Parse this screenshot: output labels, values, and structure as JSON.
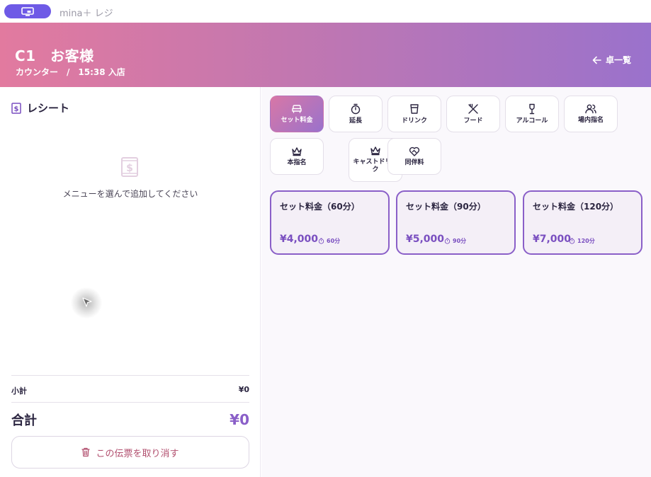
{
  "app": {
    "name": "mina＋ レジ"
  },
  "header": {
    "title": "C1　お客様",
    "subtitle": "カウンター　/　15:38 入店",
    "back_label": "卓一覧"
  },
  "receipt": {
    "heading": "レシート",
    "empty_message": "メニューを選んで追加してください",
    "subtotal_label": "小計",
    "subtotal_value": "¥0",
    "total_label": "合計",
    "total_value": "¥0",
    "cancel_label": "この伝票を取り消す"
  },
  "categories": [
    {
      "label": "セット料金",
      "icon": "sofa-icon",
      "active": true
    },
    {
      "label": "延長",
      "icon": "timer-icon"
    },
    {
      "label": "ドリンク",
      "icon": "cup-icon"
    },
    {
      "label": "フード",
      "icon": "utensils-icon"
    },
    {
      "label": "アルコール",
      "icon": "wine-icon"
    },
    {
      "label": "場内指名",
      "icon": "users-icon"
    },
    {
      "label": "本指名",
      "icon": "crown-icon"
    },
    {
      "label": "キャストドリンク",
      "icon": "crown-icon"
    },
    {
      "label": "同伴料",
      "icon": "heart-handshake-icon"
    }
  ],
  "items": [
    {
      "title": "セット料金（60分）",
      "price": "¥4,000",
      "duration": "60分"
    },
    {
      "title": "セット料金（90分）",
      "price": "¥5,000",
      "duration": "90分"
    },
    {
      "title": "セット料金（120分）",
      "price": "¥7,000",
      "duration": "120分"
    }
  ],
  "colors": {
    "accent": "#8a5fc8",
    "header_gradient_start": "#e27a9f",
    "header_gradient_end": "#9a72cc",
    "danger": "#b2506f"
  }
}
